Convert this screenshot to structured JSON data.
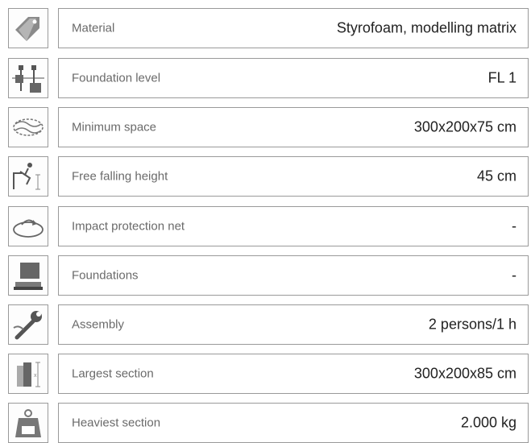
{
  "specs": [
    {
      "icon": "price-tag-icon",
      "label": "Material",
      "value": "Styrofoam, modelling matrix"
    },
    {
      "icon": "foundation-level-icon",
      "label": "Foundation level",
      "value": "FL 1"
    },
    {
      "icon": "minimum-space-icon",
      "label": "Minimum space",
      "value": "300x200x75 cm"
    },
    {
      "icon": "falling-person-icon",
      "label": "Free falling height",
      "value": "45 cm"
    },
    {
      "icon": "impact-net-icon",
      "label": "Impact protection net",
      "value": "-"
    },
    {
      "icon": "foundation-block-icon",
      "label": "Foundations",
      "value": "-"
    },
    {
      "icon": "wrench-hand-icon",
      "label": "Assembly",
      "value": "2 persons/1 h"
    },
    {
      "icon": "section-size-icon",
      "label": "Largest section",
      "value": "300x200x85 cm"
    },
    {
      "icon": "weight-kg-icon",
      "label": "Heaviest section",
      "value": "2.000 kg"
    }
  ]
}
